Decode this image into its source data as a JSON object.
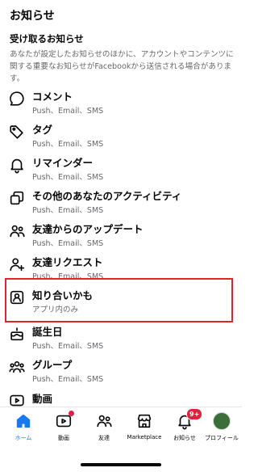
{
  "header": {
    "title": "お知らせ"
  },
  "section": {
    "title": "受け取るお知らせ",
    "description": "あなたが設定したお知らせのほかに、アカウントやコンテンツに関する重要なお知らせがFacebookから送信される場合があります。"
  },
  "items": [
    {
      "label": "コメント",
      "sub": "Push、Email、SMS",
      "icon": "comment-icon"
    },
    {
      "label": "タグ",
      "sub": "Push、Email、SMS",
      "icon": "tag-icon"
    },
    {
      "label": "リマインダー",
      "sub": "Push、Email、SMS",
      "icon": "bell-icon"
    },
    {
      "label": "その他のあなたのアクティビティ",
      "sub": "Push、Email、SMS",
      "icon": "activity-icon"
    },
    {
      "label": "友達からのアップデート",
      "sub": "Push、Email、SMS",
      "icon": "friends-update-icon"
    },
    {
      "label": "友達リクエスト",
      "sub": "Push、Email、SMS",
      "icon": "add-friend-icon"
    },
    {
      "label": "知り合いかも",
      "sub": "アプリ内のみ",
      "icon": "contact-card-icon"
    },
    {
      "label": "誕生日",
      "sub": "Push、Email、SMS",
      "icon": "cake-icon"
    },
    {
      "label": "グループ",
      "sub": "Push、Email、SMS",
      "icon": "groups-icon"
    },
    {
      "label": "動画",
      "sub": "",
      "icon": "video-icon"
    }
  ],
  "tabs": [
    {
      "label": "ホーム",
      "icon": "home-icon",
      "active": true
    },
    {
      "label": "動画",
      "icon": "video-tab-icon"
    },
    {
      "label": "友達",
      "icon": "friends-icon"
    },
    {
      "label": "Marketplace",
      "icon": "marketplace-icon"
    },
    {
      "label": "お知らせ",
      "icon": "notifications-icon",
      "badge": "9+"
    },
    {
      "label": "プロフィール",
      "icon": "profile-avatar"
    }
  ],
  "colors": {
    "accent": "#1877f2",
    "highlight": "#e0242a",
    "badge": "#e41e3f",
    "secondary_text": "#65676b"
  }
}
